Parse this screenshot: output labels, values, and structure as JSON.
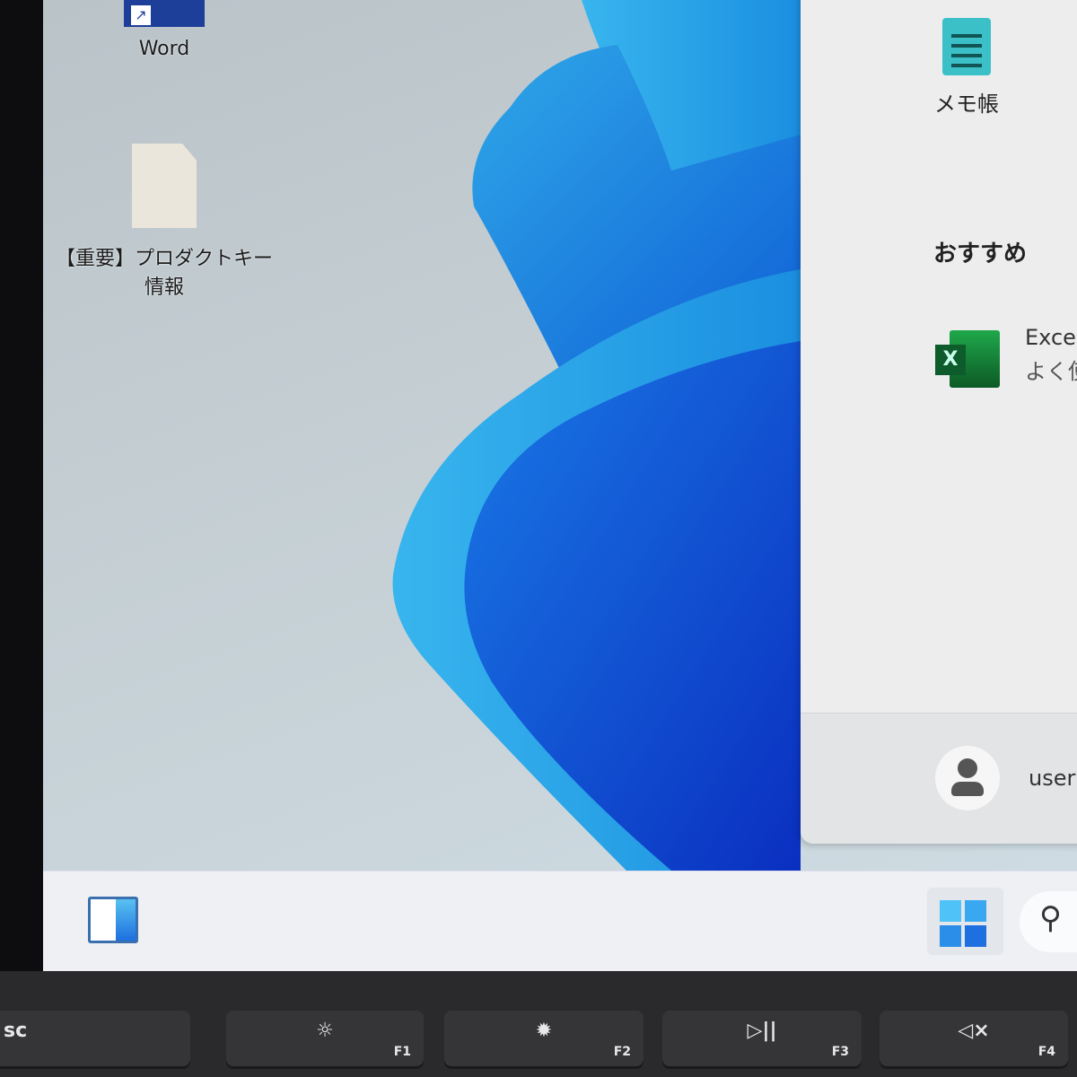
{
  "desktop": {
    "icons": [
      {
        "label": "Word",
        "icon": "word-shortcut-icon"
      },
      {
        "label_line1": "【重要】プロダクトキー",
        "label_line2": "情報",
        "icon": "text-file-icon"
      }
    ]
  },
  "start_menu": {
    "pinned": [
      {
        "label": "メモ帳",
        "icon": "notepad-icon"
      }
    ],
    "recommended_title": "おすすめ",
    "recommended": [
      {
        "title": "Excel",
        "subtitle": "よく使",
        "icon": "excel-icon"
      }
    ],
    "user": {
      "name": "user",
      "icon": "user-avatar-icon"
    }
  },
  "taskbar": {
    "items": [
      "widgets-icon",
      "start-icon",
      "search-icon"
    ]
  },
  "keyboard": {
    "keys": [
      {
        "label": "sc",
        "glyph": ""
      },
      {
        "glyph": "☼",
        "fn": "F1"
      },
      {
        "glyph": "✹",
        "fn": "F2"
      },
      {
        "glyph": "▷||",
        "fn": "F3"
      },
      {
        "glyph": "◁×",
        "fn": "F4"
      }
    ]
  },
  "colors": {
    "accent": "#1e6fe0",
    "excel": "#1e7b3a",
    "taskbar": "#eef0f3"
  }
}
